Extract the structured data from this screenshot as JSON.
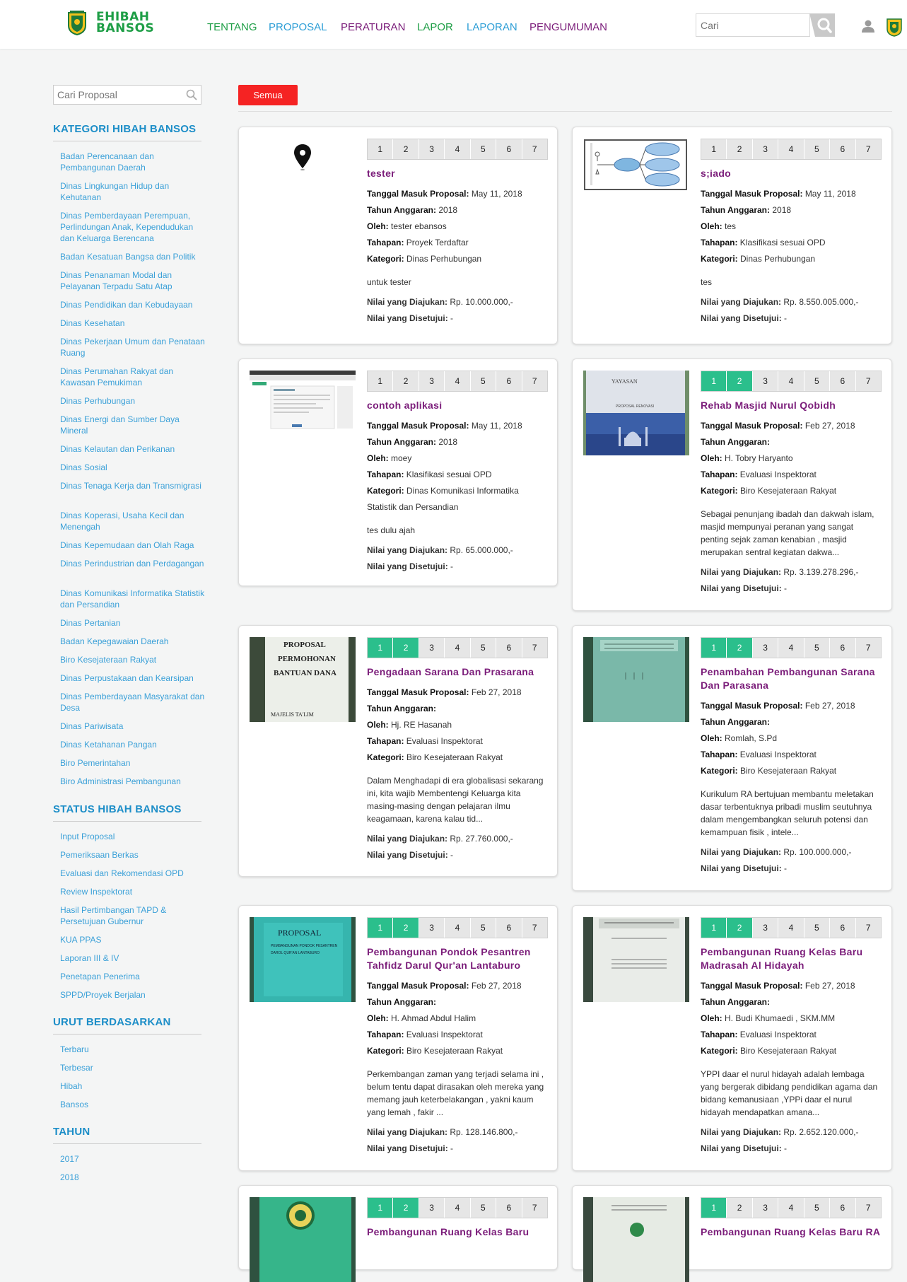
{
  "header": {
    "logo_line1": "EHIBAH",
    "logo_line2": "BANSOS",
    "nav": [
      {
        "label": "TENTANG",
        "color": "#1e9e46"
      },
      {
        "label": "PROPOSAL",
        "color": "#2d9ed6"
      },
      {
        "label": "PERATURAN",
        "color": "#7b1d7a"
      },
      {
        "label": "LAPOR",
        "color": "#1e9e46"
      },
      {
        "label": "LAPORAN",
        "color": "#2d9ed6"
      },
      {
        "label": "PENGUMUMAN",
        "color": "#7b1d7a"
      }
    ],
    "search_placeholder": "Cari"
  },
  "sidebar": {
    "search_placeholder": "Cari Proposal",
    "kategori_heading": "KATEGORI HIBAH BANSOS",
    "kategori": [
      "Badan Perencanaan dan Pembangunan Daerah",
      "Dinas Lingkungan Hidup dan Kehutanan",
      "Dinas Pemberdayaan Perempuan, Perlindungan Anak, Kependudukan dan Keluarga Berencana",
      "Badan Kesatuan Bangsa dan Politik",
      "Dinas Penanaman Modal dan Pelayanan Terpadu Satu Atap",
      "Dinas Pendidikan dan Kebudayaan",
      "Dinas Kesehatan",
      "Dinas Pekerjaan Umum dan Penataan Ruang",
      "Dinas Perumahan Rakyat dan Kawasan Pemukiman",
      "Dinas Perhubungan",
      "Dinas Energi dan Sumber Daya Mineral",
      "Dinas Kelautan dan Perikanan",
      "Dinas Sosial",
      "Dinas Tenaga Kerja dan Transmigrasi",
      "Dinas Koperasi, Usaha Kecil dan Menengah",
      "Dinas Kepemudaan dan Olah Raga",
      "Dinas Perindustrian dan Perdagangan",
      "Dinas Komunikasi Informatika Statistik dan Persandian",
      "Dinas Pertanian",
      "Badan Kepegawaian Daerah",
      "Biro Kesejateraan Rakyat",
      "Dinas Perpustakaan dan Kearsipan",
      "Dinas Pemberdayaan Masyarakat dan Desa",
      "Dinas Pariwisata",
      "Dinas Ketahanan Pangan",
      "Biro Pemerintahan",
      "Biro Administrasi Pembangunan"
    ],
    "status_heading": "STATUS HIBAH BANSOS",
    "status": [
      "Input Proposal",
      "Pemeriksaan Berkas",
      "Evaluasi dan Rekomendasi OPD",
      "Review Inspektorat",
      "Hasil Pertimbangan TAPD & Persetujuan Gubernur",
      "KUA PPAS",
      "Laporan III & IV",
      "Penetapan Penerima",
      "SPPD/Proyek Berjalan"
    ],
    "urut_heading": "URUT BERDASARKAN",
    "urut": [
      "Terbaru",
      "Terbesar",
      "Hibah",
      "Bansos"
    ],
    "tahun_heading": "TAHUN",
    "tahun": [
      "2017",
      "2018"
    ]
  },
  "filter": {
    "semua_label": "Semua"
  },
  "labels": {
    "tanggal": "Tanggal Masuk Proposal:",
    "tahun": "Tahun Anggaran:",
    "oleh": "Oleh:",
    "tahapan": "Tahapan:",
    "kategori": "Kategori:",
    "diajukan": "Nilai yang Diajukan:",
    "disetujui": "Nilai yang Disetujui:"
  },
  "steps": [
    "1",
    "2",
    "3",
    "4",
    "5",
    "6",
    "7"
  ],
  "colors": {
    "step_done": "#2bbf8c",
    "title": "#7b1d7a",
    "link": "#3aa0d8",
    "heading": "#1d8ec8",
    "semua": "#f52323"
  },
  "cards": [
    {
      "thumb": "map-pin",
      "done": 0,
      "title": "tester",
      "tanggal": "May 11, 2018",
      "tahun": "2018",
      "oleh": "tester ebansos",
      "tahapan": "Proyek Terdaftar",
      "kategori": "Dinas Perhubungan",
      "desc": "untuk tester",
      "diajukan": "Rp. 10.000.000,-",
      "disetujui": "-"
    },
    {
      "thumb": "diagram",
      "done": 0,
      "title": "s;iado",
      "tanggal": "May 11, 2018",
      "tahun": "2018",
      "oleh": "tes",
      "tahapan": "Klasifikasi sesuai OPD",
      "kategori": "Dinas Perhubungan",
      "desc": "tes",
      "diajukan": "Rp. 8.550.005.000,-",
      "disetujui": "-"
    },
    {
      "thumb": "screenshot",
      "done": 0,
      "title": "contoh aplikasi",
      "tanggal": "May 11, 2018",
      "tahun": "2018",
      "oleh": "moey",
      "tahapan": "Klasifikasi sesuai OPD",
      "kategori": "Dinas Komunikasi Informatika Statistik dan Persandian",
      "desc": "tes dulu ajah",
      "diajukan": "Rp. 65.000.000,-",
      "disetujui": "-"
    },
    {
      "thumb": "mosque",
      "done": 2,
      "title": "Rehab Masjid Nurul Qobidh",
      "tanggal": "Feb 27, 2018",
      "tahun": "",
      "oleh": "H. Tobry Haryanto",
      "tahapan": "Evaluasi Inspektorat",
      "kategori": "Biro Kesejateraan Rakyat",
      "desc": "Sebagai penunjang ibadah dan dakwah islam, masjid mempunyai peranan yang sangat penting sejak zaman kenabian , masjid merupakan sentral kegiatan dakwa...",
      "diajukan": "Rp. 3.139.278.296,-",
      "disetujui": "-"
    },
    {
      "thumb": "document",
      "done": 2,
      "title": "Pengadaan Sarana Dan Prasarana",
      "tanggal": "Feb 27, 2018",
      "tahun": "",
      "oleh": "Hj. RE Hasanah",
      "tahapan": "Evaluasi Inspektorat",
      "kategori": "Biro Kesejateraan Rakyat",
      "desc": "Dalam Menghadapi di era globalisasi sekarang ini, kita wajib Membentengi Keluarga kita masing-masing dengan pelajaran ilmu keagamaan, karena kalau tid...",
      "diajukan": "Rp. 27.760.000,-",
      "disetujui": "-"
    },
    {
      "thumb": "green-doc",
      "done": 2,
      "title": "Penambahan Pembangunan Sarana Dan Parasana",
      "tanggal": "Feb 27, 2018",
      "tahun": "",
      "oleh": "Romlah, S.Pd",
      "tahapan": "Evaluasi Inspektorat",
      "kategori": "Biro Kesejateraan Rakyat",
      "desc": "Kurikulum RA bertujuan membantu meletakan dasar terbentuknya pribadi muslim seutuhnya dalam mengembangkan seluruh potensi dan kemampuan fisik , intele...",
      "diajukan": "Rp. 100.000.000,-",
      "disetujui": "-"
    },
    {
      "thumb": "teal-doc",
      "done": 2,
      "title": "Pembangunan Pondok Pesantren Tahfidz Darul Qur'an Lantaburo",
      "tanggal": "Feb 27, 2018",
      "tahun": "",
      "oleh": "H. Ahmad Abdul Halim",
      "tahapan": "Evaluasi Inspektorat",
      "kategori": "Biro Kesejateraan Rakyat",
      "desc": "Perkembangan zaman yang terjadi selama ini , belum tentu dapat dirasakan oleh mereka yang memang jauh keterbelakangan , yakni kaum yang lemah , fakir ...",
      "diajukan": "Rp. 128.146.800,-",
      "disetujui": "-"
    },
    {
      "thumb": "white-doc",
      "done": 2,
      "title": "Pembangunan Ruang Kelas Baru Madrasah Al Hidayah",
      "tanggal": "Feb 27, 2018",
      "tahun": "",
      "oleh": "H. Budi Khumaedi , SKM.MM",
      "tahapan": "Evaluasi Inspektorat",
      "kategori": "Biro Kesejateraan Rakyat",
      "desc": "YPPI daar el nurul hidayah adalah lembaga yang bergerak dibidang pendidikan agama dan bidang kemanusiaan ,YPPi daar el nurul hidayah mendapatkan amana...",
      "diajukan": "Rp. 2.652.120.000,-",
      "disetujui": "-"
    },
    {
      "thumb": "green-emblem",
      "done": 2,
      "title": "Pembangunan Ruang Kelas Baru",
      "tanggal": "",
      "tahun": "",
      "oleh": "",
      "tahapan": "",
      "kategori": "",
      "desc": "",
      "diajukan": "",
      "disetujui": ""
    },
    {
      "thumb": "doc-emblem",
      "done": 1,
      "title": "Pembangunan Ruang Kelas Baru RA",
      "tanggal": "",
      "tahun": "",
      "oleh": "",
      "tahapan": "",
      "kategori": "",
      "desc": "",
      "diajukan": "",
      "disetujui": ""
    }
  ]
}
